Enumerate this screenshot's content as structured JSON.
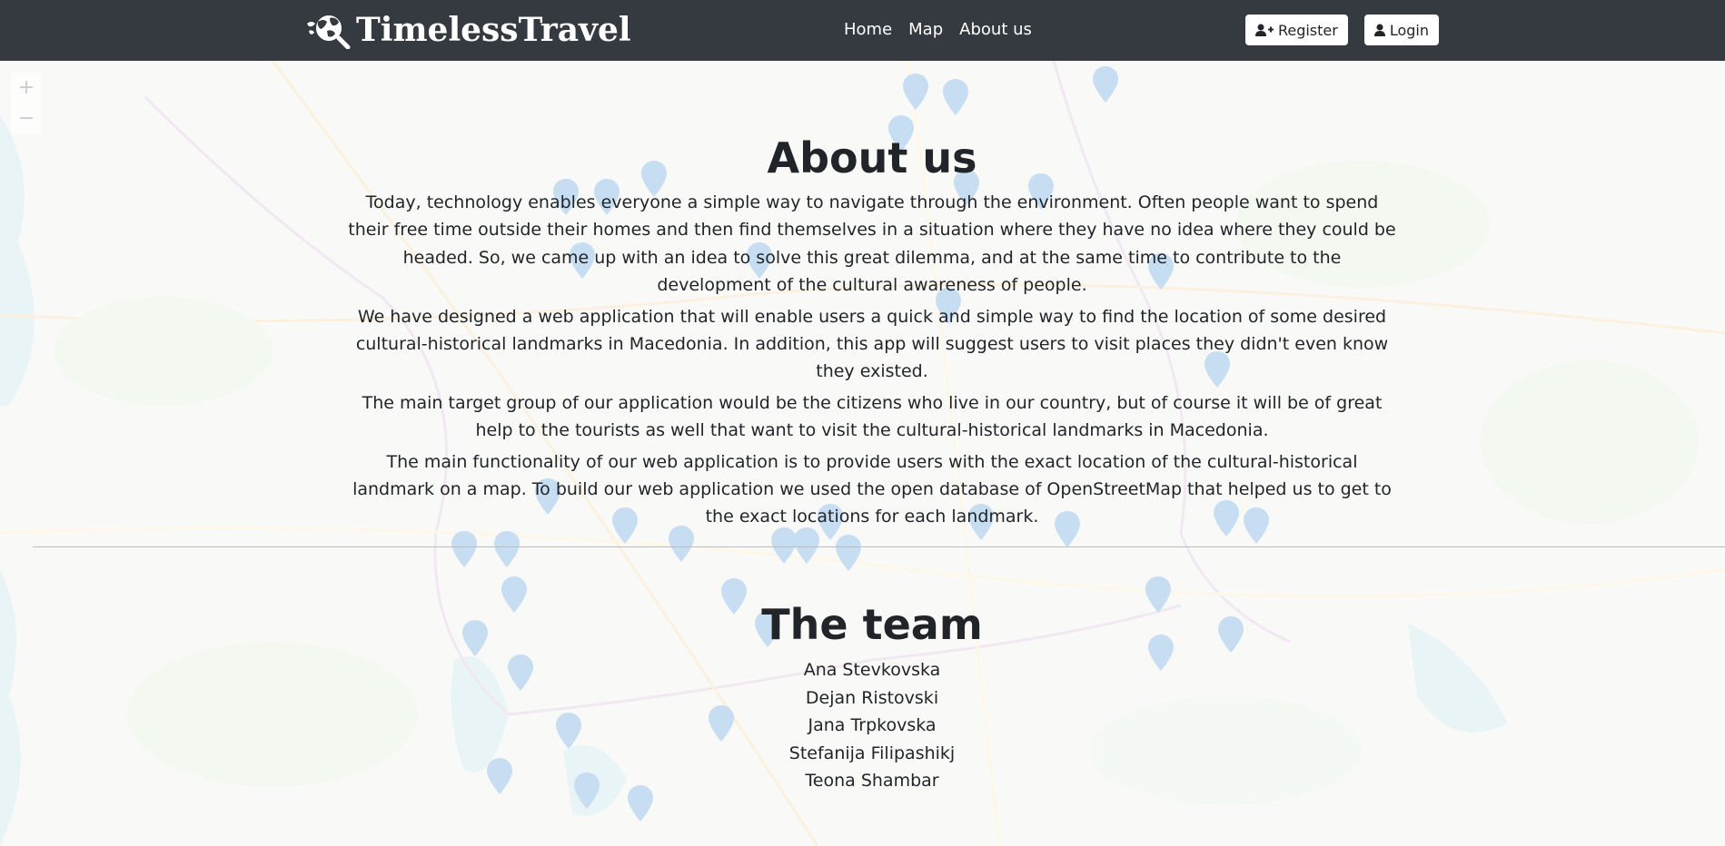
{
  "brand": {
    "name": "TimelessTravel",
    "logo_icon": "globe-magnifier-icon"
  },
  "nav": {
    "items": [
      {
        "label": "Home"
      },
      {
        "label": "Map"
      },
      {
        "label": "About us"
      }
    ]
  },
  "auth": {
    "register_label": "Register",
    "register_icon": "user-plus-icon",
    "login_label": "Login",
    "login_icon": "user-icon"
  },
  "map_controls": {
    "zoom_in": "+",
    "zoom_out": "−"
  },
  "about": {
    "title": "About us",
    "paragraphs": [
      "Today, technology enables everyone a simple way to navigate through the environment. Often people want to spend their free time outside their homes and then find themselves in a situation where they have no idea where they could be headed. So, we came up with an idea to solve this great dilemma, and at the same time to contribute to the development of the cultural awareness of people.",
      "We have designed a web application that will enable users a quick and simple way to find the location of some desired cultural-historical landmarks in Macedonia. In addition, this app will suggest users to visit places they didn't even know they existed.",
      "The main target group of our application would be the citizens who live in our country, but of course it will be of great help to the tourists as well that want to visit the cultural-historical landmarks in Macedonia.",
      "The main functionality of our web application is to provide users with the exact location of the cultural-historical landmark on a map. To build our web application we used the open database of OpenStreetMap that helped us to get to the exact locations for each landmark."
    ]
  },
  "team": {
    "title": "The team",
    "members": [
      "Ana Stevkovska",
      "Dejan Ristovski",
      "Jana Trpkovska",
      "Stefanija Filipashikj",
      "Teona Shambar"
    ]
  },
  "colors": {
    "navbar": "#343a40",
    "marker": "#2a81cb",
    "text": "#212529"
  }
}
